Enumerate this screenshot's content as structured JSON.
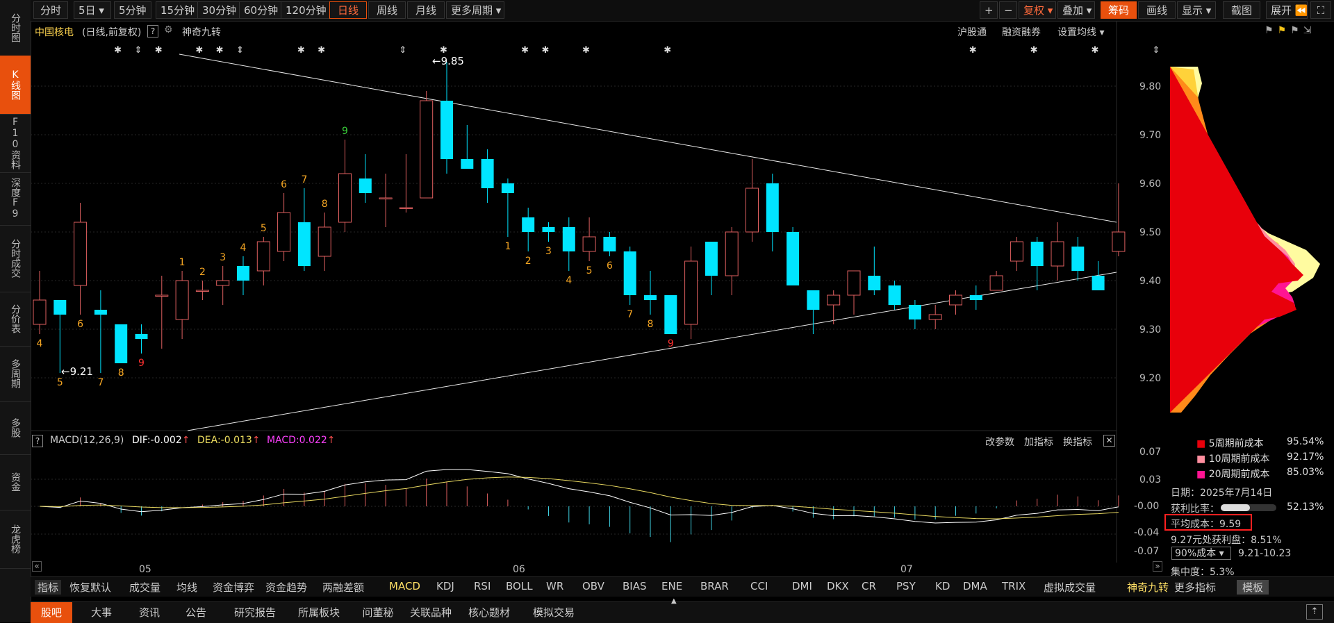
{
  "sidebar": {
    "items": [
      {
        "label": "分时图"
      },
      {
        "label": "K线图"
      },
      {
        "label": "F10资料"
      },
      {
        "label": "深度F9"
      },
      {
        "label": "分时成交"
      },
      {
        "label": "分价表"
      },
      {
        "label": "多周期"
      },
      {
        "label": "多股"
      },
      {
        "label": "资金"
      },
      {
        "label": "龙虎榜"
      }
    ]
  },
  "toolbar": {
    "periods": [
      "分时",
      "5日",
      "5分钟",
      "15分钟",
      "30分钟",
      "60分钟",
      "120分钟",
      "日线",
      "周线",
      "月线",
      "更多周期"
    ],
    "right": {
      "plus": "+",
      "minus": "−",
      "fuquan": "复权",
      "diejia": "叠加",
      "chouma": "筹码",
      "huaxian": "画线",
      "xianshi": "显示",
      "jieguan": "截图",
      "zhankai": "展开"
    }
  },
  "header": {
    "stock_name": "中国核电",
    "mode": "(日线,前复权)",
    "help": "?",
    "indicator": "神奇九转",
    "links": [
      "沪股通",
      "融资融券",
      "设置均线"
    ]
  },
  "price_axis": {
    "labels": [
      "9.80",
      "9.70",
      "9.60",
      "9.50",
      "9.40",
      "9.30",
      "9.20"
    ]
  },
  "annotations": {
    "high": "9.85",
    "low": "9.21"
  },
  "candles": [
    {
      "o": 9.31,
      "h": 9.42,
      "l": 9.29,
      "c": 9.36
    },
    {
      "o": 9.36,
      "h": 9.36,
      "l": 9.21,
      "c": 9.33
    },
    {
      "o": 9.39,
      "h": 9.56,
      "l": 9.33,
      "c": 9.52
    },
    {
      "o": 9.34,
      "h": 9.38,
      "l": 9.21,
      "c": 9.33
    },
    {
      "o": 9.31,
      "h": 9.31,
      "l": 9.23,
      "c": 9.23
    },
    {
      "o": 9.29,
      "h": 9.31,
      "l": 9.25,
      "c": 9.28
    },
    {
      "o": 9.37,
      "h": 9.41,
      "l": 9.26,
      "c": 9.37
    },
    {
      "o": 9.32,
      "h": 9.42,
      "l": 9.28,
      "c": 9.4
    },
    {
      "o": 9.38,
      "h": 9.4,
      "l": 9.36,
      "c": 9.38
    },
    {
      "o": 9.39,
      "h": 9.43,
      "l": 9.35,
      "c": 9.4
    },
    {
      "o": 9.43,
      "h": 9.45,
      "l": 9.37,
      "c": 9.4
    },
    {
      "o": 9.42,
      "h": 9.49,
      "l": 9.39,
      "c": 9.48
    },
    {
      "o": 9.46,
      "h": 9.58,
      "l": 9.44,
      "c": 9.54
    },
    {
      "o": 9.52,
      "h": 9.59,
      "l": 9.42,
      "c": 9.43
    },
    {
      "o": 9.45,
      "h": 9.54,
      "l": 9.42,
      "c": 9.51
    },
    {
      "o": 9.52,
      "h": 9.69,
      "l": 9.5,
      "c": 9.62
    },
    {
      "o": 9.61,
      "h": 9.66,
      "l": 9.56,
      "c": 9.58
    },
    {
      "o": 9.57,
      "h": 9.62,
      "l": 9.51,
      "c": 9.57
    },
    {
      "o": 9.55,
      "h": 9.66,
      "l": 9.54,
      "c": 9.55
    },
    {
      "o": 9.57,
      "h": 9.79,
      "l": 9.57,
      "c": 9.77
    },
    {
      "o": 9.77,
      "h": 9.85,
      "l": 9.62,
      "c": 9.65
    },
    {
      "o": 9.65,
      "h": 9.72,
      "l": 9.63,
      "c": 9.63
    },
    {
      "o": 9.65,
      "h": 9.67,
      "l": 9.56,
      "c": 9.59
    },
    {
      "o": 9.6,
      "h": 9.61,
      "l": 9.49,
      "c": 9.58
    },
    {
      "o": 9.53,
      "h": 9.55,
      "l": 9.46,
      "c": 9.5
    },
    {
      "o": 9.51,
      "h": 9.52,
      "l": 9.48,
      "c": 9.5
    },
    {
      "o": 9.51,
      "h": 9.53,
      "l": 9.42,
      "c": 9.46
    },
    {
      "o": 9.46,
      "h": 9.53,
      "l": 9.44,
      "c": 9.49
    },
    {
      "o": 9.49,
      "h": 9.5,
      "l": 9.45,
      "c": 9.46
    },
    {
      "o": 9.46,
      "h": 9.47,
      "l": 9.35,
      "c": 9.37
    },
    {
      "o": 9.37,
      "h": 9.42,
      "l": 9.33,
      "c": 9.36
    },
    {
      "o": 9.37,
      "h": 9.37,
      "l": 9.29,
      "c": 9.29
    },
    {
      "o": 9.31,
      "h": 9.47,
      "l": 9.28,
      "c": 9.44
    },
    {
      "o": 9.48,
      "h": 9.48,
      "l": 9.37,
      "c": 9.41
    },
    {
      "o": 9.41,
      "h": 9.51,
      "l": 9.37,
      "c": 9.5
    },
    {
      "o": 9.5,
      "h": 9.65,
      "l": 9.48,
      "c": 9.59
    },
    {
      "o": 9.6,
      "h": 9.62,
      "l": 9.46,
      "c": 9.5
    },
    {
      "o": 9.5,
      "h": 9.51,
      "l": 9.39,
      "c": 9.39
    },
    {
      "o": 9.38,
      "h": 9.38,
      "l": 9.29,
      "c": 9.34
    },
    {
      "o": 9.35,
      "h": 9.38,
      "l": 9.31,
      "c": 9.37
    },
    {
      "o": 9.37,
      "h": 9.42,
      "l": 9.33,
      "c": 9.42
    },
    {
      "o": 9.41,
      "h": 9.47,
      "l": 9.37,
      "c": 9.38
    },
    {
      "o": 9.39,
      "h": 9.4,
      "l": 9.34,
      "c": 9.35
    },
    {
      "o": 9.35,
      "h": 9.36,
      "l": 9.3,
      "c": 9.32
    },
    {
      "o": 9.32,
      "h": 9.35,
      "l": 9.3,
      "c": 9.33
    },
    {
      "o": 9.35,
      "h": 9.38,
      "l": 9.33,
      "c": 9.37
    },
    {
      "o": 9.37,
      "h": 9.39,
      "l": 9.34,
      "c": 9.36
    },
    {
      "o": 9.38,
      "h": 9.42,
      "l": 9.38,
      "c": 9.41
    },
    {
      "o": 9.44,
      "h": 9.49,
      "l": 9.42,
      "c": 9.48
    },
    {
      "o": 9.48,
      "h": 9.49,
      "l": 9.38,
      "c": 9.43
    },
    {
      "o": 9.43,
      "h": 9.52,
      "l": 9.4,
      "c": 9.48
    },
    {
      "o": 9.47,
      "h": 9.49,
      "l": 9.4,
      "c": 9.42
    },
    {
      "o": 9.41,
      "h": 9.44,
      "l": 9.38,
      "c": 9.38
    },
    {
      "o": 9.46,
      "h": 9.6,
      "l": 9.45,
      "c": 9.5
    }
  ],
  "nine_turn_labels": [
    {
      "i": 0,
      "t": "4",
      "pos": "below",
      "color": "#f5a623"
    },
    {
      "i": 1,
      "t": "5",
      "pos": "below",
      "color": "#f5a623"
    },
    {
      "i": 2,
      "t": "6",
      "pos": "below",
      "color": "#f5a623"
    },
    {
      "i": 3,
      "t": "7",
      "pos": "below",
      "color": "#f5a623"
    },
    {
      "i": 4,
      "t": "8",
      "pos": "below",
      "color": "#f5a623"
    },
    {
      "i": 5,
      "t": "9",
      "pos": "below",
      "color": "#ff3030"
    },
    {
      "i": 7,
      "t": "1",
      "pos": "above",
      "color": "#f5a623"
    },
    {
      "i": 8,
      "t": "2",
      "pos": "above",
      "color": "#f5a623"
    },
    {
      "i": 9,
      "t": "3",
      "pos": "above",
      "color": "#f5a623"
    },
    {
      "i": 10,
      "t": "4",
      "pos": "above",
      "color": "#f5a623"
    },
    {
      "i": 11,
      "t": "5",
      "pos": "above",
      "color": "#f5a623"
    },
    {
      "i": 12,
      "t": "6",
      "pos": "above",
      "color": "#f5a623"
    },
    {
      "i": 13,
      "t": "7",
      "pos": "above",
      "color": "#f5a623"
    },
    {
      "i": 14,
      "t": "8",
      "pos": "above",
      "color": "#f5a623"
    },
    {
      "i": 15,
      "t": "9",
      "pos": "above",
      "color": "#3ad03a"
    },
    {
      "i": 23,
      "t": "1",
      "pos": "below",
      "color": "#f5a623"
    },
    {
      "i": 24,
      "t": "2",
      "pos": "below",
      "color": "#f5a623"
    },
    {
      "i": 25,
      "t": "3",
      "pos": "below",
      "color": "#f5a623"
    },
    {
      "i": 26,
      "t": "4",
      "pos": "below",
      "color": "#f5a623"
    },
    {
      "i": 27,
      "t": "5",
      "pos": "below",
      "color": "#f5a623"
    },
    {
      "i": 28,
      "t": "6",
      "pos": "below",
      "color": "#f5a623"
    },
    {
      "i": 29,
      "t": "7",
      "pos": "below",
      "color": "#f5a623"
    },
    {
      "i": 30,
      "t": "8",
      "pos": "below",
      "color": "#f5a623"
    },
    {
      "i": 31,
      "t": "9",
      "pos": "below",
      "color": "#ff3030"
    }
  ],
  "event_markers": [
    {
      "i": 2,
      "t": "✱"
    },
    {
      "i": 3,
      "t": "⇕"
    },
    {
      "i": 4,
      "t": "✱"
    },
    {
      "i": 6,
      "t": "✱"
    },
    {
      "i": 7,
      "t": "✱"
    },
    {
      "i": 8,
      "t": "⇕"
    },
    {
      "i": 11,
      "t": "✱"
    },
    {
      "i": 12,
      "t": "✱"
    },
    {
      "i": 16,
      "t": "⇕"
    },
    {
      "i": 18,
      "t": "✱"
    },
    {
      "i": 22,
      "t": "✱"
    },
    {
      "i": 23,
      "t": "✱"
    },
    {
      "i": 25,
      "t": "✱"
    },
    {
      "i": 29,
      "t": "✱"
    },
    {
      "i": 44,
      "t": "✱"
    },
    {
      "i": 47,
      "t": "✱"
    },
    {
      "i": 50,
      "t": "✱"
    },
    {
      "i": 53,
      "t": "⇕"
    }
  ],
  "macd": {
    "title": "MACD(12,26,9)",
    "dif": "DIF:-0.002",
    "dea": "DEA:-0.013",
    "macd": "MACD:0.022",
    "buttons": [
      "改参数",
      "加指标",
      "换指标"
    ],
    "axis": [
      "0.07",
      "0.03",
      "-0.00",
      "-0.04",
      "-0.07"
    ],
    "months": [
      "05",
      "06",
      "07"
    ]
  },
  "chip": {
    "legend": [
      {
        "label": "5周期前成本",
        "value": "95.54%",
        "color": "#e8000b"
      },
      {
        "label": "10周期前成本",
        "value": "92.17%",
        "color": "#ff8fa0"
      },
      {
        "label": "20周期前成本",
        "value": "85.03%",
        "color": "#ff1493"
      }
    ],
    "date": "日期：2025年7月14日",
    "profit_label": "获利比率：",
    "profit_value": "52.13%",
    "profit_ratio": 0.5213,
    "avg_cost": "平均成本：9.59",
    "profit_at": "9.27元处获利盘：8.51%",
    "cost_select": "90%成本",
    "cost_range": "9.21-10.23",
    "concentration": "集中度：5.3%"
  },
  "indicator_tabs": [
    "指标",
    "恢复默认",
    "成交量",
    "均线",
    "资金博弈",
    "资金趋势",
    "两融差额",
    "MACD",
    "KDJ",
    "RSI",
    "BOLL",
    "WR",
    "OBV",
    "BIAS",
    "ENE",
    "BRAR",
    "CCI",
    "DMI",
    "DKX",
    "CR",
    "PSY",
    "KD",
    "DMA",
    "TRIX",
    "虚拟成交量",
    "神奇九转",
    "更多指标",
    "模板"
  ],
  "bottom_tabs": [
    "股吧",
    "大事",
    "资讯",
    "公告",
    "研究报告",
    "所属板块",
    "问董秘",
    "关联品种",
    "核心题材",
    "模拟交易"
  ]
}
